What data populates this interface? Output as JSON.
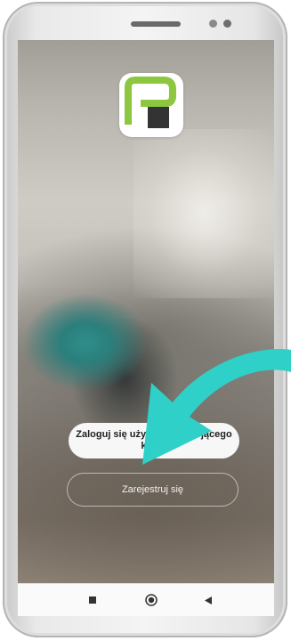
{
  "screen": {
    "login_label": "Zaloguj się używając istniejącego konta",
    "register_label": "Zarejestruj się"
  },
  "navigation": {
    "items": [
      {
        "name": "recent-apps-icon"
      },
      {
        "name": "home-icon"
      },
      {
        "name": "back-icon"
      }
    ]
  },
  "colors": {
    "logo_green": "#8dc63f",
    "logo_square": "#333333",
    "arrow_teal": "#2fd0c8"
  }
}
